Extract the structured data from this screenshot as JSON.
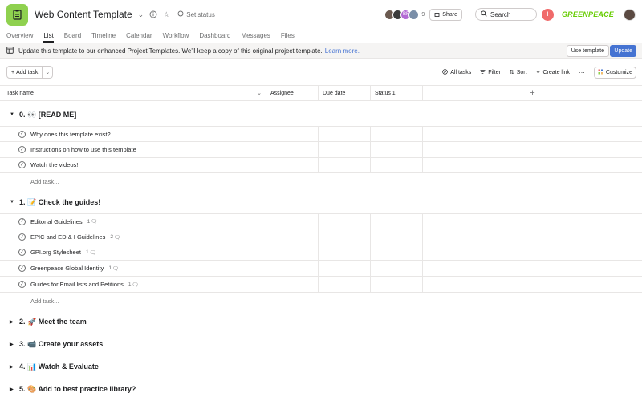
{
  "project": {
    "title": "Web Content Template",
    "set_status": "Set status",
    "member_count": "9",
    "share_label": "Share",
    "search_placeholder": "Search",
    "org_logo": "GREENPEACE"
  },
  "tabs": [
    "Overview",
    "List",
    "Board",
    "Timeline",
    "Calendar",
    "Workflow",
    "Dashboard",
    "Messages",
    "Files"
  ],
  "active_tab": "List",
  "banner": {
    "text": "Update this template to our enhanced Project Templates. We'll keep a copy of this original project template.",
    "link": "Learn more.",
    "use_template_label": "Use template",
    "update_label": "Update"
  },
  "toolbar": {
    "add_task_label": "Add task",
    "all_tasks": "All tasks",
    "filter": "Filter",
    "sort": "Sort",
    "create_link": "Create link",
    "more": "···",
    "customize": "Customize"
  },
  "columns": {
    "task_name": "Task name",
    "assignee": "Assignee",
    "due_date": "Due date",
    "status": "Status 1"
  },
  "sections": [
    {
      "name": "0. 👀 [READ ME]",
      "expanded": true,
      "tasks": [
        {
          "name": "Why does this template exist?",
          "comments": ""
        },
        {
          "name": "Instructions on how to use this template",
          "comments": ""
        },
        {
          "name": "Watch the videos!!",
          "comments": ""
        }
      ]
    },
    {
      "name": "1. 📝 Check the guides!",
      "expanded": true,
      "tasks": [
        {
          "name": "Editorial Guidelines",
          "comments": "1"
        },
        {
          "name": "EPIC and ED & I Guidelines",
          "comments": "2"
        },
        {
          "name": "GPI.org Stylesheet",
          "comments": "1"
        },
        {
          "name": "Greenpeace Global Identity",
          "comments": "1"
        },
        {
          "name": "Guides for Email lists and Petitions",
          "comments": "1"
        }
      ]
    },
    {
      "name": "2. 🚀 Meet the team",
      "expanded": false,
      "tasks": []
    },
    {
      "name": "3. 📹 Create your assets",
      "expanded": false,
      "tasks": []
    },
    {
      "name": "4. 📊 Watch & Evaluate",
      "expanded": false,
      "tasks": []
    },
    {
      "name": "5. 🎨 Add to best practice library?",
      "expanded": false,
      "tasks": []
    }
  ],
  "add_task_row": "Add task...",
  "colors": {
    "project_icon": "#8fd14f",
    "update_button": "#4573d2",
    "add_button": "#f06a6a",
    "logo": "#66cc00"
  }
}
